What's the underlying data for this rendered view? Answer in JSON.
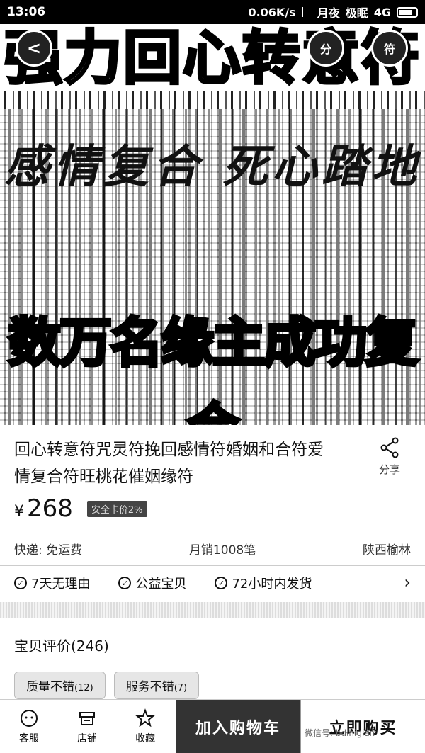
{
  "status_bar": {
    "time": "13:06",
    "speed": "0.06K/s",
    "mode1": "月夜",
    "mode2": "极眠",
    "network": "4G"
  },
  "hero": {
    "title": "强力回心转意符",
    "subtitle": "感情复合 死心踏地",
    "slogan": "数万名缘主成功复合",
    "back_label": "<",
    "share_label": "分",
    "more_label": "符"
  },
  "product": {
    "title": "回心转意符咒灵符挽回感情符婚姻和合符爱情复合符旺桃花催姻缘符",
    "share_label": "分享",
    "price_symbol": "¥",
    "price": "268",
    "badge": "安全卡价2%",
    "shipping": "快递: 免运费",
    "monthly_sales": "月销1008笔",
    "location": "陕西榆林"
  },
  "guarantees": [
    {
      "label": "7天无理由"
    },
    {
      "label": "公益宝贝"
    },
    {
      "label": "72小时内发货"
    }
  ],
  "reviews": {
    "title": "宝贝评价(246)",
    "tags": [
      {
        "label": "质量不错",
        "count": "(12)"
      },
      {
        "label": "服务不错",
        "count": "(7)"
      }
    ]
  },
  "bottom_bar": {
    "service": "客服",
    "shop": "店铺",
    "favorite": "收藏",
    "add_to_cart": "加入购物车",
    "buy_now": "立即购买"
  },
  "watermark": "微信号: bdlhigian"
}
